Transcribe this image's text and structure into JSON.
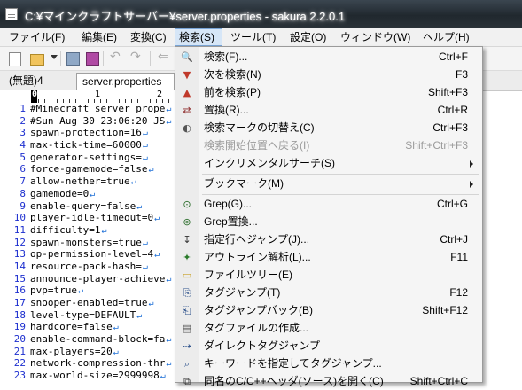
{
  "window": {
    "title": "C:¥マインクラフトサーバー¥server.properties - sakura 2.2.0.1"
  },
  "menubar": [
    {
      "label": "ファイル(F)"
    },
    {
      "label": "編集(E)"
    },
    {
      "label": "変換(C)"
    },
    {
      "label": "検索(S)"
    },
    {
      "label": "ツール(T)"
    },
    {
      "label": "設定(O)"
    },
    {
      "label": "ウィンドウ(W)"
    },
    {
      "label": "ヘルプ(H)"
    }
  ],
  "toolbar": {
    "icons": [
      "new-file-icon",
      "open-folder-icon",
      "dropdown-arrow-icon",
      "save-icon",
      "save-all-icon",
      "undo-icon",
      "redo-icon",
      "back-icon"
    ]
  },
  "tabs": [
    {
      "label": "(無題)4"
    },
    {
      "label": "server.properties"
    }
  ],
  "ruler": {
    "cursor_label": "0",
    "label_1": "1",
    "label_2": "2"
  },
  "editor": {
    "eol_mark": "↵",
    "lines": [
      {
        "num": "1",
        "text": "#Minecraft server prope"
      },
      {
        "num": "2",
        "text": "#Sun Aug 30 23:06:20 JS"
      },
      {
        "num": "3",
        "text": "spawn-protection=16"
      },
      {
        "num": "4",
        "text": "max-tick-time=60000"
      },
      {
        "num": "5",
        "text": "generator-settings="
      },
      {
        "num": "6",
        "text": "force-gamemode=false"
      },
      {
        "num": "7",
        "text": "allow-nether=true"
      },
      {
        "num": "8",
        "text": "gamemode=0"
      },
      {
        "num": "9",
        "text": "enable-query=false"
      },
      {
        "num": "10",
        "text": "player-idle-timeout=0"
      },
      {
        "num": "11",
        "text": "difficulty=1"
      },
      {
        "num": "12",
        "text": "spawn-monsters=true"
      },
      {
        "num": "13",
        "text": "op-permission-level=4"
      },
      {
        "num": "14",
        "text": "resource-pack-hash="
      },
      {
        "num": "15",
        "text": "announce-player-achieve"
      },
      {
        "num": "16",
        "text": "pvp=true"
      },
      {
        "num": "17",
        "text": "snooper-enabled=true"
      },
      {
        "num": "18",
        "text": "level-type=DEFAULT"
      },
      {
        "num": "19",
        "text": "hardcore=false"
      },
      {
        "num": "20",
        "text": "enable-command-block=fa"
      },
      {
        "num": "21",
        "text": "max-players=20"
      },
      {
        "num": "22",
        "text": "network-compression-thr"
      },
      {
        "num": "23",
        "text": "max-world-size=2999998"
      }
    ]
  },
  "search_menu": {
    "items": [
      {
        "label": "検索(F)...",
        "shortcut": "Ctrl+F",
        "icon": "find-icon",
        "enabled": true
      },
      {
        "label": "次を検索(N)",
        "shortcut": "F3",
        "icon": "find-next-icon",
        "enabled": true
      },
      {
        "label": "前を検索(P)",
        "shortcut": "Shift+F3",
        "icon": "find-prev-icon",
        "enabled": true
      },
      {
        "label": "置換(R)...",
        "shortcut": "Ctrl+R",
        "icon": "replace-icon",
        "enabled": true
      },
      {
        "label": "検索マークの切替え(C)",
        "shortcut": "Ctrl+F3",
        "icon": "toggle-mark-icon",
        "enabled": true
      },
      {
        "label": "検索開始位置へ戻る(I)",
        "shortcut": "Shift+Ctrl+F3",
        "icon": "",
        "enabled": false
      },
      {
        "label": "インクリメンタルサーチ(S)",
        "shortcut": "",
        "icon": "",
        "enabled": true,
        "submenu": true
      },
      {
        "label": "ブックマーク(M)",
        "shortcut": "",
        "icon": "",
        "enabled": true,
        "submenu": true
      },
      {
        "label": "Grep(G)...",
        "shortcut": "Ctrl+G",
        "icon": "grep-icon",
        "enabled": true
      },
      {
        "label": "Grep置換...",
        "shortcut": "",
        "icon": "grep-replace-icon",
        "enabled": true
      },
      {
        "label": "指定行へジャンプ(J)...",
        "shortcut": "Ctrl+J",
        "icon": "jump-line-icon",
        "enabled": true
      },
      {
        "label": "アウトライン解析(L)...",
        "shortcut": "F11",
        "icon": "outline-icon",
        "enabled": true
      },
      {
        "label": "ファイルツリー(E)",
        "shortcut": "",
        "icon": "folder-icon",
        "enabled": true
      },
      {
        "label": "タグジャンプ(T)",
        "shortcut": "F12",
        "icon": "tag-jump-icon",
        "enabled": true
      },
      {
        "label": "タグジャンプバック(B)",
        "shortcut": "Shift+F12",
        "icon": "tag-jump-back-icon",
        "enabled": true
      },
      {
        "label": "タグファイルの作成...",
        "shortcut": "",
        "icon": "tag-file-icon",
        "enabled": true
      },
      {
        "label": "ダイレクトタグジャンプ",
        "shortcut": "",
        "icon": "direct-tag-jump-icon",
        "enabled": true
      },
      {
        "label": "キーワードを指定してタグジャンプ...",
        "shortcut": "",
        "icon": "keyword-tag-jump-icon",
        "enabled": true
      },
      {
        "label": "同名のC/C++ヘッダ(ソース)を開く(C)",
        "shortcut": "Shift+Ctrl+C",
        "icon": "open-header-icon",
        "enabled": true
      }
    ]
  }
}
